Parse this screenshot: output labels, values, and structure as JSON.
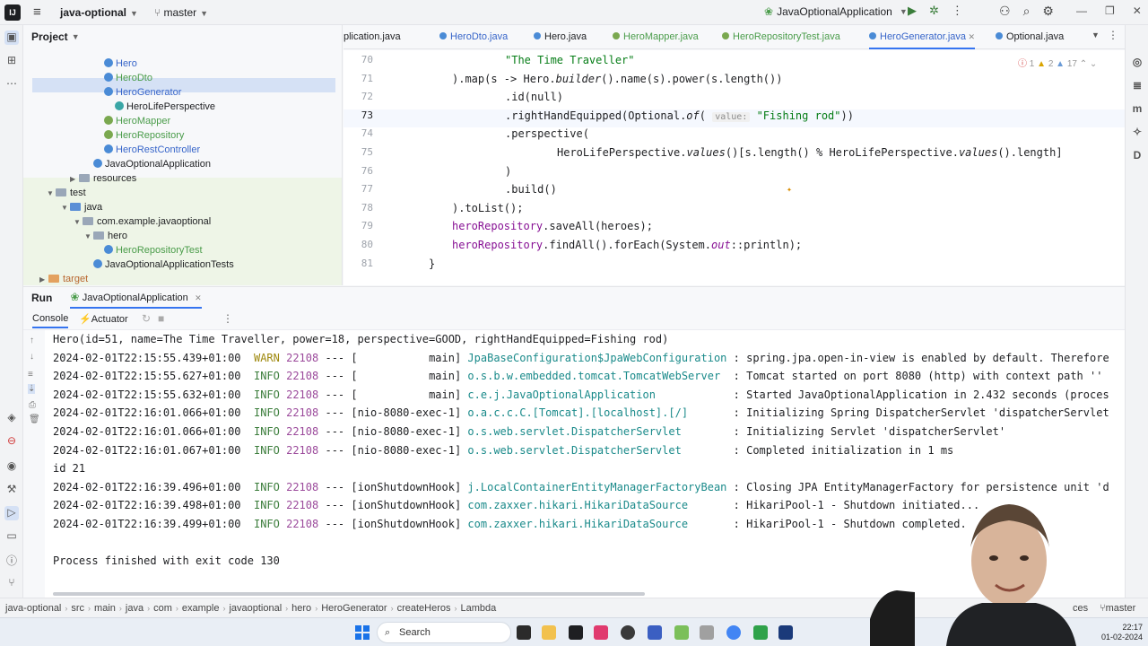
{
  "titlebar": {
    "logo": "IJ",
    "project": "java-optional",
    "branch": "master",
    "run_config": "JavaOptionalApplication"
  },
  "project_panel": {
    "title": "Project",
    "items": [
      {
        "label": "Hero",
        "kind": "class",
        "color": "blue"
      },
      {
        "label": "HeroDto",
        "kind": "class",
        "color": "green"
      },
      {
        "label": "HeroGenerator",
        "kind": "class",
        "color": "blue",
        "selected": true
      },
      {
        "label": "HeroLifePerspective",
        "kind": "class",
        "color": "dark"
      },
      {
        "label": "HeroMapper",
        "kind": "class",
        "color": "green"
      },
      {
        "label": "HeroRepository",
        "kind": "class",
        "color": "green"
      },
      {
        "label": "HeroRestController",
        "kind": "class",
        "color": "blue"
      },
      {
        "label": "JavaOptionalApplication",
        "kind": "class",
        "color": "dark"
      },
      {
        "label": "resources",
        "kind": "folder",
        "color": "dark"
      },
      {
        "label": "test",
        "kind": "folder",
        "color": "dark"
      },
      {
        "label": "java",
        "kind": "folder",
        "color": "dark"
      },
      {
        "label": "com.example.javaoptional",
        "kind": "package",
        "color": "dark"
      },
      {
        "label": "hero",
        "kind": "package",
        "color": "dark"
      },
      {
        "label": "HeroRepositoryTest",
        "kind": "class",
        "color": "green"
      },
      {
        "label": "JavaOptionalApplicationTests",
        "kind": "class",
        "color": "dark"
      },
      {
        "label": "target",
        "kind": "folder",
        "color": "orange"
      }
    ]
  },
  "editor": {
    "tabs": [
      {
        "label": "plication.java"
      },
      {
        "label": "HeroDto.java"
      },
      {
        "label": "Hero.java"
      },
      {
        "label": "HeroMapper.java"
      },
      {
        "label": "HeroRepositoryTest.java"
      },
      {
        "label": "HeroGenerator.java",
        "active": true
      },
      {
        "label": "Optional.java"
      }
    ],
    "inspection": {
      "errors": "1",
      "warnings": "2",
      "weak": "17"
    },
    "lines": [
      {
        "n": "70",
        "code_str": "\"The Time Traveller\""
      },
      {
        "n": "71",
        "code_a": ").map(s -> Hero.",
        "code_b": "builder",
        "code_c": "().name(s).power(s.length())"
      },
      {
        "n": "72",
        "code_a": ".id(null)"
      },
      {
        "n": "73",
        "code_a": ".rightHandEquipped(Optional.",
        "code_b": "of",
        "code_c": "(",
        "hint": "value:",
        "code_str": "\"Fishing rod\"",
        "code_d": "))"
      },
      {
        "n": "74",
        "code_a": ".perspective("
      },
      {
        "n": "75",
        "code_a": "HeroLifePerspective.",
        "code_b": "values",
        "code_c": "()[s.length() % HeroLifePerspective.",
        "code_b2": "values",
        "code_d": "().length]"
      },
      {
        "n": "76",
        "code_a": ")"
      },
      {
        "n": "77",
        "code_a": ".build()"
      },
      {
        "n": "78",
        "code_a": ").toList();"
      },
      {
        "n": "79",
        "code_f": "heroRepository",
        "code_a": ".saveAll(heroes);"
      },
      {
        "n": "80",
        "code_f": "heroRepository",
        "code_a": ".findAll().forEach(System.",
        "code_fo": "out",
        "code_d": "::println);"
      },
      {
        "n": "81",
        "code_a": "}"
      }
    ]
  },
  "run_panel": {
    "title": "Run",
    "config_tab": "JavaOptionalApplication",
    "console_tab": "Console",
    "actuator_tab": "Actuator",
    "lines": [
      {
        "text": "Hero(id=51, name=The Time Traveller, power=18, perspective=GOOD, rightHandEquipped=Fishing rod)"
      },
      {
        "ts": "2024-02-01T22:15:55.439+01:00",
        "lvl": "WARN",
        "pid": "22108",
        "thread": "--- [           main]",
        "logger": "JpaBaseConfiguration$JpaWebConfiguration",
        "msg": ": spring.jpa.open-in-view is enabled by default. Therefore"
      },
      {
        "ts": "2024-02-01T22:15:55.627+01:00",
        "lvl": "INFO",
        "pid": "22108",
        "thread": "--- [           main]",
        "logger": "o.s.b.w.embedded.tomcat.TomcatWebServer ",
        "msg": ": Tomcat started on port 8080 (http) with context path ''"
      },
      {
        "ts": "2024-02-01T22:15:55.632+01:00",
        "lvl": "INFO",
        "pid": "22108",
        "thread": "--- [           main]",
        "logger": "c.e.j.JavaOptionalApplication           ",
        "msg": ": Started JavaOptionalApplication in 2.432 seconds (proces"
      },
      {
        "ts": "2024-02-01T22:16:01.066+01:00",
        "lvl": "INFO",
        "pid": "22108",
        "thread": "--- [nio-8080-exec-1]",
        "logger": "o.a.c.c.C.[Tomcat].[localhost].[/]      ",
        "msg": ": Initializing Spring DispatcherServlet 'dispatcherServlet"
      },
      {
        "ts": "2024-02-01T22:16:01.066+01:00",
        "lvl": "INFO",
        "pid": "22108",
        "thread": "--- [nio-8080-exec-1]",
        "logger": "o.s.web.servlet.DispatcherServlet       ",
        "msg": ": Initializing Servlet 'dispatcherServlet'"
      },
      {
        "ts": "2024-02-01T22:16:01.067+01:00",
        "lvl": "INFO",
        "pid": "22108",
        "thread": "--- [nio-8080-exec-1]",
        "logger": "o.s.web.servlet.DispatcherServlet       ",
        "msg": ": Completed initialization in 1 ms"
      },
      {
        "text": "id 21"
      },
      {
        "ts": "2024-02-01T22:16:39.496+01:00",
        "lvl": "INFO",
        "pid": "22108",
        "thread": "--- [ionShutdownHook]",
        "logger": "j.LocalContainerEntityManagerFactoryBean",
        "msg": ": Closing JPA EntityManagerFactory for persistence unit 'd"
      },
      {
        "ts": "2024-02-01T22:16:39.498+01:00",
        "lvl": "INFO",
        "pid": "22108",
        "thread": "--- [ionShutdownHook]",
        "logger": "com.zaxxer.hikari.HikariDataSource      ",
        "msg": ": HikariPool-1 - Shutdown initiated..."
      },
      {
        "ts": "2024-02-01T22:16:39.499+01:00",
        "lvl": "INFO",
        "pid": "22108",
        "thread": "--- [ionShutdownHook]",
        "logger": "com.zaxxer.hikari.HikariDataSource      ",
        "msg": ": HikariPool-1 - Shutdown completed."
      },
      {
        "text": ""
      },
      {
        "text": "Process finished with exit code 130"
      }
    ]
  },
  "breadcrumb": [
    "java-optional",
    "src",
    "main",
    "java",
    "com",
    "example",
    "javaoptional",
    "hero",
    "HeroGenerator",
    "createHeros",
    "Lambda"
  ],
  "status_right": {
    "ending": "ces",
    "branch": "master"
  },
  "taskbar": {
    "search_placeholder": "Search",
    "time": "22:17",
    "date": "01-02-2024"
  },
  "colors": {
    "accent": "#3574f0",
    "string": "#067d17",
    "field": "#871094",
    "info": "#3b7d3b",
    "warn": "#9e880d",
    "logger": "#1a8a8a"
  }
}
